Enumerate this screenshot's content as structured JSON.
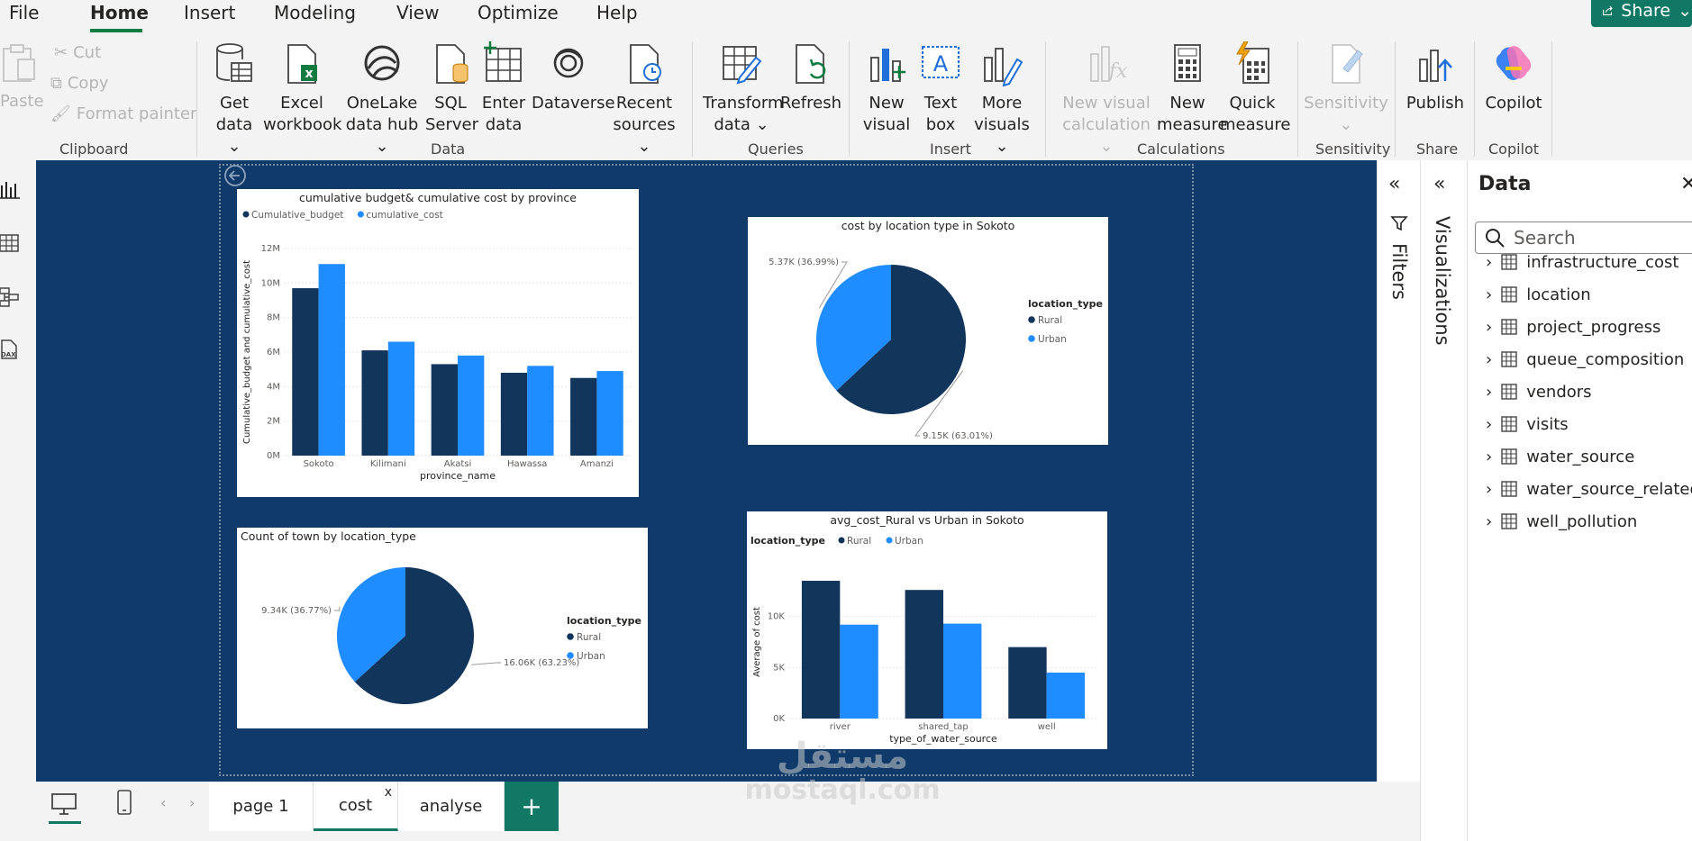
{
  "menu": {
    "items": [
      "File",
      "Home",
      "Insert",
      "Modeling",
      "View",
      "Optimize",
      "Help"
    ],
    "share_label": "Share"
  },
  "ribbon": {
    "clipboard": {
      "paste": "Paste",
      "cut": "Cut",
      "copy": "Copy",
      "format_painter": "Format painter",
      "group": "Clipboard"
    },
    "data": {
      "get_data": [
        "Get",
        "data"
      ],
      "excel": [
        "Excel",
        "workbook"
      ],
      "onelake": [
        "OneLake",
        "data hub"
      ],
      "sql": [
        "SQL",
        "Server"
      ],
      "enter": [
        "Enter",
        "data"
      ],
      "dataverse": "Dataverse",
      "recent": [
        "Recent",
        "sources"
      ],
      "group": "Data"
    },
    "queries": {
      "transform": [
        "Transform",
        "data"
      ],
      "refresh": "Refresh",
      "group": "Queries"
    },
    "insert": {
      "new_visual": [
        "New",
        "visual"
      ],
      "text_box": [
        "Text",
        "box"
      ],
      "more_visuals": [
        "More",
        "visuals"
      ],
      "group": "Insert"
    },
    "calculations": {
      "new_visual_calc": [
        "New visual",
        "calculation"
      ],
      "new_measure": [
        "New",
        "measure"
      ],
      "quick_measure": [
        "Quick",
        "measure"
      ],
      "group": "Calculations"
    },
    "sensitivity": {
      "label": "Sensitivity",
      "group": "Sensitivity"
    },
    "share": {
      "publish": "Publish",
      "group": "Share"
    },
    "copilot": {
      "label": "Copilot",
      "group": "Copilot"
    }
  },
  "panes": {
    "filters": "Filters",
    "visualizations": "Visualizations",
    "data_title": "Data",
    "search_placeholder": "Search",
    "tables": [
      "infrastructure_cost",
      "location",
      "project_progress",
      "queue_composition",
      "vendors",
      "visits",
      "water_source",
      "water_source_related_...",
      "well_pollution"
    ]
  },
  "tabs": {
    "pages": [
      "page 1",
      "cost",
      "analyse"
    ],
    "close": "x",
    "add": "+"
  },
  "watermark": {
    "arabic": "مستقل",
    "latin": "mostaql.com"
  },
  "colors": {
    "dark": "#12355b",
    "light": "#1f8cff",
    "canvas": "#0f3a6a",
    "accent": "#117865"
  },
  "chart_data": [
    {
      "type": "bar",
      "title": "cumulative budget& cumulative cost by province",
      "xlabel": "province_name",
      "ylabel": "Cumulative_budget and cumulative_cost",
      "categories": [
        "Sokoto",
        "Kilimani",
        "Akatsi",
        "Hawassa",
        "Amanzi"
      ],
      "series": [
        {
          "name": "Cumulative_budget",
          "values": [
            9.7,
            6.1,
            5.3,
            4.8,
            4.5
          ]
        },
        {
          "name": "cumulative_cost",
          "values": [
            11.1,
            6.6,
            5.8,
            5.2,
            4.9
          ]
        }
      ],
      "yticks": [
        "0M",
        "2M",
        "4M",
        "6M",
        "8M",
        "10M",
        "12M"
      ],
      "ylim": [
        0,
        12
      ]
    },
    {
      "type": "pie",
      "title": "cost by location type in Sokoto",
      "legend_title": "location_type",
      "slices": [
        {
          "name": "Rural",
          "value": 63.01,
          "label": "9.15K (63.01%)"
        },
        {
          "name": "Urban",
          "value": 36.99,
          "label": "5.37K (36.99%)"
        }
      ]
    },
    {
      "type": "pie",
      "title": "Count of town by location_type",
      "legend_title": "location_type",
      "slices": [
        {
          "name": "Rural",
          "value": 63.23,
          "label": "16.06K (63.23%)"
        },
        {
          "name": "Urban",
          "value": 36.77,
          "label": "9.34K (36.77%)"
        }
      ]
    },
    {
      "type": "bar",
      "title": "avg_cost_Rural vs Urban in Sokoto",
      "legend_title": "location_type",
      "xlabel": "type_of_water_source",
      "ylabel": "Average of cost",
      "categories": [
        "river",
        "shared_tap",
        "well"
      ],
      "series": [
        {
          "name": "Rural",
          "values": [
            13.5,
            12.6,
            7.0
          ]
        },
        {
          "name": "Urban",
          "values": [
            9.2,
            9.3,
            4.5
          ]
        }
      ],
      "yticks": [
        "0K",
        "5K",
        "10K"
      ],
      "ylim": [
        0,
        15
      ]
    }
  ]
}
